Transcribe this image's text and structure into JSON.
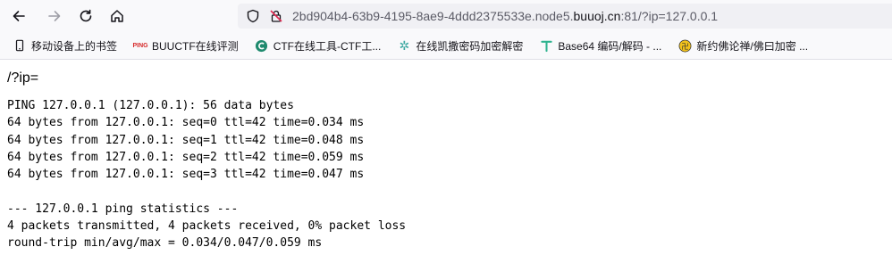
{
  "browser": {
    "url": {
      "prefix": "2bd904b4-63b9-4195-8ae9-4ddd2375533e.node5.",
      "domain": "buuoj.cn",
      "suffix": ":81/?ip=127.0.0.1"
    }
  },
  "bookmarks": [
    {
      "label": "移动设备上的书签",
      "icon": "mobile-icon"
    },
    {
      "label": "BUUCTF在线评测",
      "icon": "ping-icon",
      "icon_text": "PING"
    },
    {
      "label": "CTF在线工具-CTF工...",
      "icon": "c-logo-icon"
    },
    {
      "label": "在线凯撒密码加密解密",
      "icon": "gear-icon"
    },
    {
      "label": "Base64 编码/解码 - ...",
      "icon": "t-logo-icon"
    },
    {
      "label": "新约佛论禅/佛曰加密 ...",
      "icon": "buddha-icon"
    }
  ],
  "page": {
    "heading": "/?ip=",
    "output_lines": [
      "PING 127.0.0.1 (127.0.0.1): 56 data bytes",
      "64 bytes from 127.0.0.1: seq=0 ttl=42 time=0.034 ms",
      "64 bytes from 127.0.0.1: seq=1 ttl=42 time=0.048 ms",
      "64 bytes from 127.0.0.1: seq=2 ttl=42 time=0.059 ms",
      "64 bytes from 127.0.0.1: seq=3 ttl=42 time=0.047 ms",
      "",
      "--- 127.0.0.1 ping statistics ---",
      "4 packets transmitted, 4 packets received, 0% packet loss",
      "round-trip min/avg/max = 0.034/0.047/0.059 ms"
    ]
  },
  "colors": {
    "chrome_bg": "#f9f9fb",
    "urlbar_bg": "#f0f0f4",
    "insecure_red": "#e22850"
  }
}
